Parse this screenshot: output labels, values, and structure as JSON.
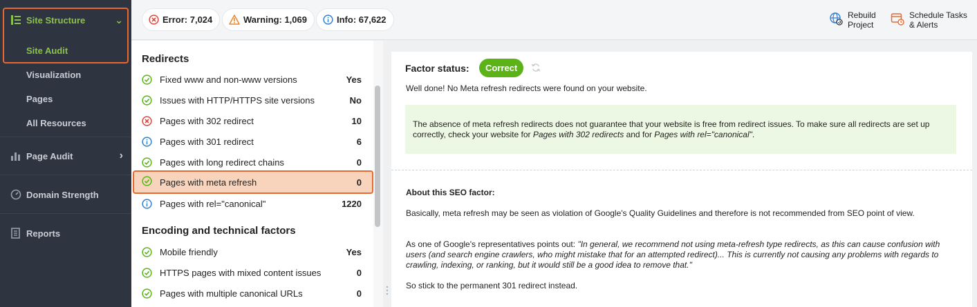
{
  "sidebar": {
    "site_structure": "Site Structure",
    "site_audit": "Site Audit",
    "visualization": "Visualization",
    "pages": "Pages",
    "all_resources": "All Resources",
    "page_audit": "Page Audit",
    "domain_strength": "Domain Strength",
    "reports": "Reports"
  },
  "topbar": {
    "error": "Error: 7,024",
    "warning": "Warning: 1,069",
    "info": "Info: 67,622",
    "rebuild_line1": "Rebuild",
    "rebuild_line2": "Project",
    "schedule_line1": "Schedule Tasks",
    "schedule_line2": "& Alerts"
  },
  "list": {
    "section1": "Redirects",
    "section2": "Encoding and technical factors",
    "rows": [
      {
        "label": "Fixed www and non-www versions",
        "value": "Yes",
        "status": "ok"
      },
      {
        "label": "Issues with HTTP/HTTPS site versions",
        "value": "No",
        "status": "ok"
      },
      {
        "label": "Pages with 302 redirect",
        "value": "10",
        "status": "error"
      },
      {
        "label": "Pages with 301 redirect",
        "value": "6",
        "status": "info"
      },
      {
        "label": "Pages with long redirect chains",
        "value": "0",
        "status": "ok"
      },
      {
        "label": "Pages with meta refresh",
        "value": "0",
        "status": "ok"
      },
      {
        "label": "Pages with rel=\"canonical\"",
        "value": "1220",
        "status": "info"
      },
      {
        "label": "Mobile friendly",
        "value": "Yes",
        "status": "ok"
      },
      {
        "label": "HTTPS pages with mixed content issues",
        "value": "0",
        "status": "ok"
      },
      {
        "label": "Pages with multiple canonical URLs",
        "value": "0",
        "status": "ok"
      }
    ]
  },
  "detail": {
    "factor_label": "Factor status:",
    "factor_badge": "Correct",
    "well_done": "Well done! No Meta refresh redirects were found on your website.",
    "note_a": "The absence of meta refresh redirects does not guarantee that your website is free from redirect issues. To make sure all redirects are set up correctly, check your website for ",
    "note_b": "Pages with 302 redirects",
    "note_c": " and for ",
    "note_d": "Pages with rel=\"canonical\"",
    "note_e": ".",
    "about_head": "About this SEO factor:",
    "about_p1": "Basically, meta refresh may be seen as violation of Google's Quality Guidelines and therefore is not recommended from SEO point of view.",
    "about_p2a": "As one of Google's representatives points out: ",
    "about_p2b": "\"In general, we recommend not using meta-refresh type redirects, as this can cause confusion with users (and search engine crawlers, who might mistake that for an attempted redirect)... This is currently not causing any problems with regards to crawling, indexing, or ranking, but it would still be a good idea to remove that.\"",
    "about_p3": "So stick to the permanent 301 redirect instead."
  },
  "colors": {
    "accent_orange": "#e8682f",
    "correct_green": "#5bb318",
    "error_red": "#d9453b",
    "info_blue": "#2f7fd0",
    "sidebar_bg": "#2f3540"
  }
}
